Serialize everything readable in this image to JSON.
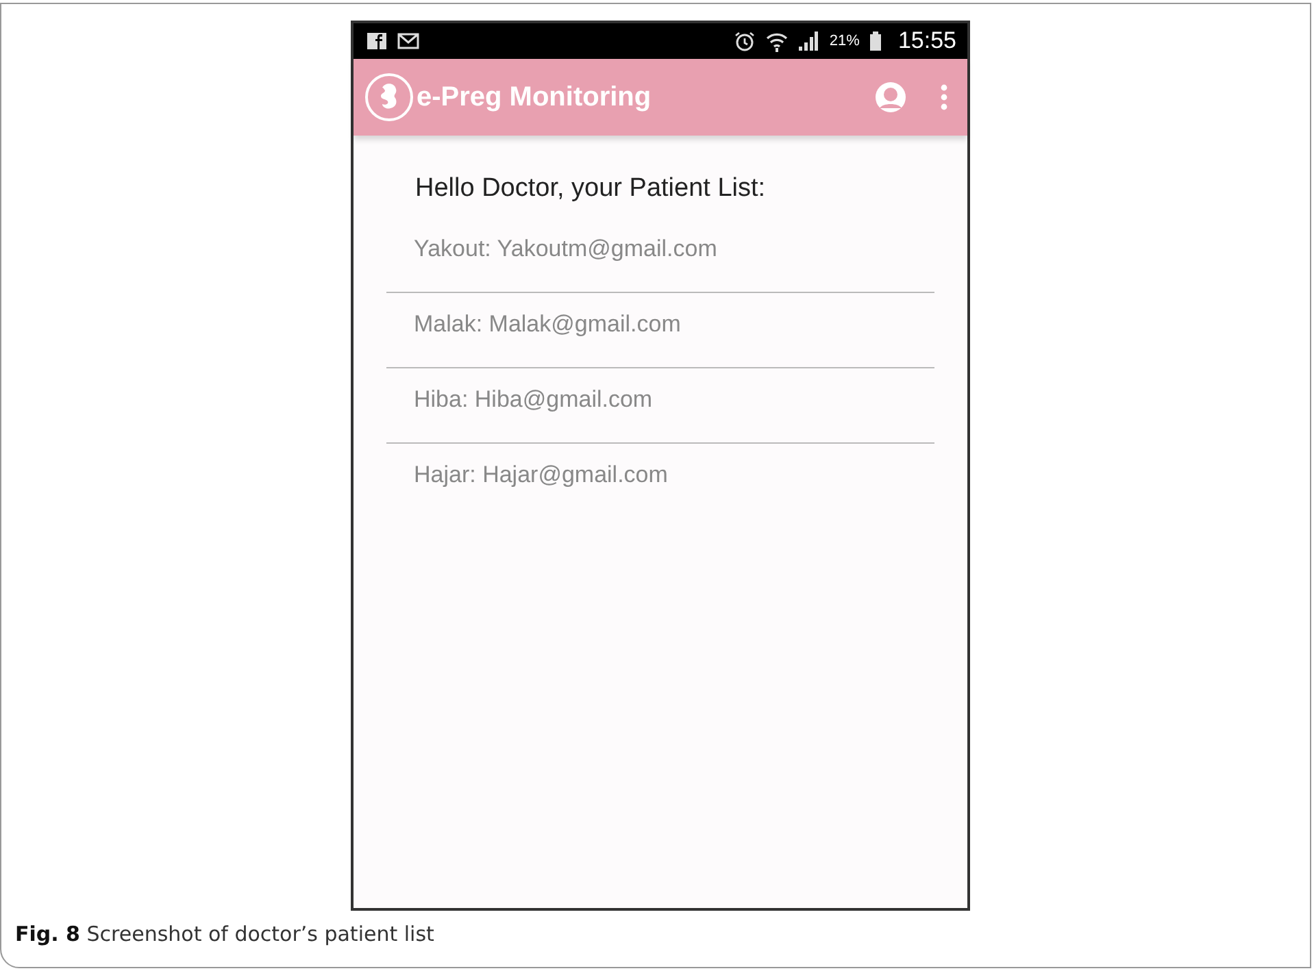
{
  "status_bar": {
    "battery": "21%",
    "time": "15:55"
  },
  "app_bar": {
    "title": "e-Preg Monitoring"
  },
  "heading": "Hello Doctor, your Patient List:",
  "patients": [
    {
      "label": "Yakout: Yakoutm@gmail.com"
    },
    {
      "label": "Malak: Malak@gmail.com"
    },
    {
      "label": "Hiba: Hiba@gmail.com"
    },
    {
      "label": "Hajar: Hajar@gmail.com"
    }
  ],
  "caption": "**Fig. 8**  Screenshot of doctor’s patient list"
}
